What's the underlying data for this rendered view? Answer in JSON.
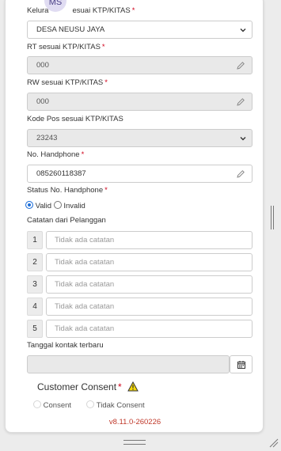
{
  "avatar": {
    "initials": "MS"
  },
  "kelurahan": {
    "label_a": "Kelura",
    "label_b": "esuai KTP/KITAS",
    "value": "DESA NEUSU JAYA"
  },
  "rt": {
    "label": "RT sesuai KTP/KITAS",
    "value": "000"
  },
  "rw": {
    "label": "RW sesuai KTP/KITAS",
    "value": "000"
  },
  "kodepos": {
    "label": "Kode Pos sesuai KTP/KITAS",
    "value": "23243"
  },
  "phone": {
    "label": "No. Handphone",
    "value": "085260118387"
  },
  "status": {
    "label": "Status No. Handphone",
    "options": [
      "Valid",
      "Invalid"
    ],
    "selected": "Valid"
  },
  "notes": {
    "label": "Catatan dari Pelanggan",
    "items": [
      {
        "num": "1",
        "placeholder": "Tidak ada catatan"
      },
      {
        "num": "2",
        "placeholder": "Tidak ada catatan"
      },
      {
        "num": "3",
        "placeholder": "Tidak ada catatan"
      },
      {
        "num": "4",
        "placeholder": "Tidak ada catatan"
      },
      {
        "num": "5",
        "placeholder": "Tidak ada catatan"
      }
    ]
  },
  "contact_date": {
    "label": "Tanggal kontak terbaru",
    "value": ""
  },
  "consent": {
    "title": "Customer Consent",
    "options": [
      "Consent",
      "Tidak Consent"
    ]
  },
  "required_mark": "*",
  "version": "v8.11.0-260226",
  "colors": {
    "required": "#d0021b",
    "radio_active": "#1e6fd9",
    "warning": "#f5d90a",
    "version": "#c0392b"
  }
}
